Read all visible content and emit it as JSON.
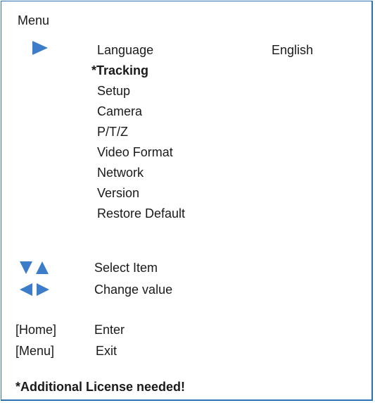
{
  "menu": {
    "title": "Menu",
    "items": [
      {
        "label": "Language",
        "value": "English"
      },
      {
        "label": "*Tracking"
      },
      {
        "label": "Setup"
      },
      {
        "label": "Camera"
      },
      {
        "label": "P/T/Z"
      },
      {
        "label": "Video Format"
      },
      {
        "label": "Network"
      },
      {
        "label": "Version"
      },
      {
        "label": "Restore Default"
      }
    ],
    "selected_item": "Language"
  },
  "legend": {
    "select_label": "Select Item",
    "change_label": "Change value",
    "home_key": "[Home]",
    "home_action": "Enter",
    "menu_key": "[Menu]",
    "menu_action": "Exit"
  },
  "footnote": "*Additional License needed!",
  "colors": {
    "accent": "#3d7cc9",
    "border": "#2f6fb0"
  },
  "icons": {
    "cursor": "right-triangle-icon",
    "select": "down-up-triangles-icon",
    "change": "left-right-triangles-icon"
  }
}
